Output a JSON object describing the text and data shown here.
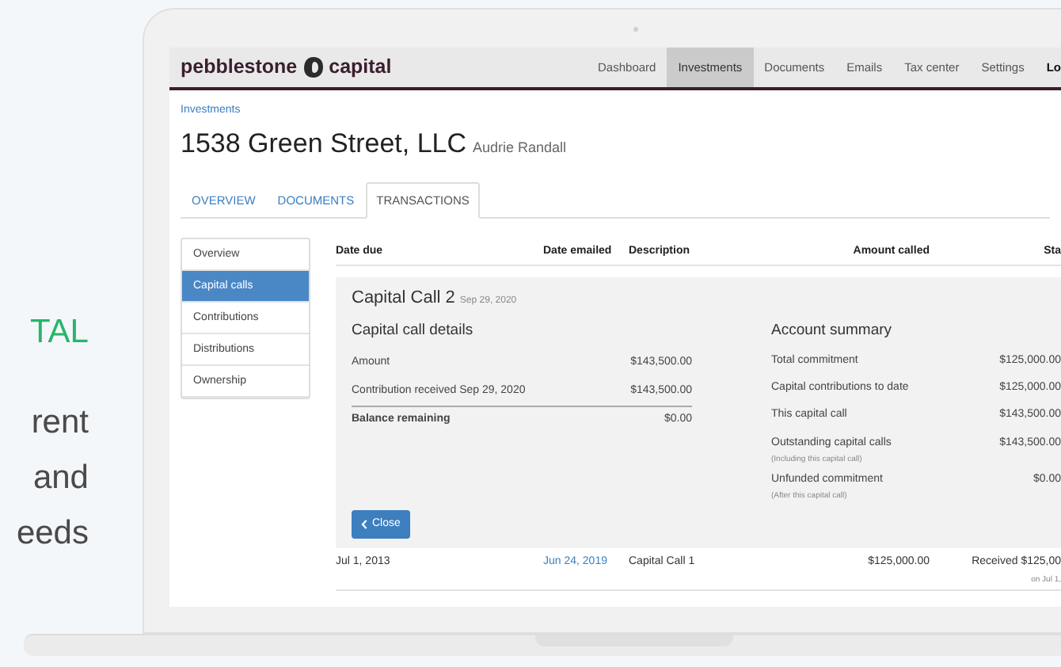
{
  "marketing": [
    {
      "text": "TAL",
      "kind": "accent"
    },
    {
      "text": "rent",
      "kind": "plain"
    },
    {
      "text": "and",
      "kind": "plain"
    },
    {
      "text": "eeds",
      "kind": "plain"
    }
  ],
  "header": {
    "logo_left": "pebblestone",
    "logo_right": "capital",
    "nav": [
      {
        "label": "Dashboard",
        "selected": false
      },
      {
        "label": "Investments",
        "selected": true
      },
      {
        "label": "Documents",
        "selected": false
      },
      {
        "label": "Emails",
        "selected": false
      },
      {
        "label": "Tax center",
        "selected": false
      },
      {
        "label": "Settings",
        "selected": false
      },
      {
        "label": "Lo",
        "selected": false
      }
    ]
  },
  "breadcrumb": "Investments",
  "title": "1538 Green Street, LLC",
  "subtitle": "Audrie Randall",
  "tabs": [
    {
      "label": "OVERVIEW",
      "selected": false
    },
    {
      "label": "DOCUMENTS",
      "selected": false
    },
    {
      "label": "TRANSACTIONS",
      "selected": true
    }
  ],
  "sidebar": [
    {
      "label": "Overview",
      "selected": false
    },
    {
      "label": "Capital calls",
      "selected": true
    },
    {
      "label": "Contributions",
      "selected": false
    },
    {
      "label": "Distributions",
      "selected": false
    },
    {
      "label": "Ownership",
      "selected": false
    }
  ],
  "table": {
    "columns": [
      "Date due",
      "Date emailed",
      "Description",
      "Amount called",
      "Sta"
    ],
    "expanded": {
      "title": "Capital Call 2",
      "date": "Sep 29, 2020",
      "details_heading": "Capital call details",
      "details": [
        {
          "label": "Amount",
          "value": "$143,500.00",
          "kind": "plain"
        },
        {
          "label": "Contribution received Sep 29, 2020",
          "value": "$143,500.00",
          "kind": "plain"
        },
        {
          "label": "Balance remaining",
          "value": "$0.00",
          "kind": "total"
        }
      ],
      "summary_heading": "Account summary",
      "summary": [
        {
          "label": "Total commitment",
          "value": "$125,000.00"
        },
        {
          "label": "Capital contributions to date",
          "value": "$125,000.00"
        },
        {
          "label": "This capital call",
          "value": "$143,500.00"
        },
        {
          "label": "Outstanding capital calls",
          "note": "(Including this capital call)",
          "value": "$143,500.00"
        },
        {
          "label": "Unfunded commitment",
          "note": "(After this capital call)",
          "value": "$0.00"
        }
      ],
      "close_button": "Close"
    },
    "rows": [
      {
        "date_due": "Jul 1, 2013",
        "date_emailed": "Jun 24, 2019",
        "description": "Capital Call 1",
        "amount": "$125,000.00",
        "status": "Received $125,00",
        "status_note": "on Jul 1,"
      }
    ]
  }
}
